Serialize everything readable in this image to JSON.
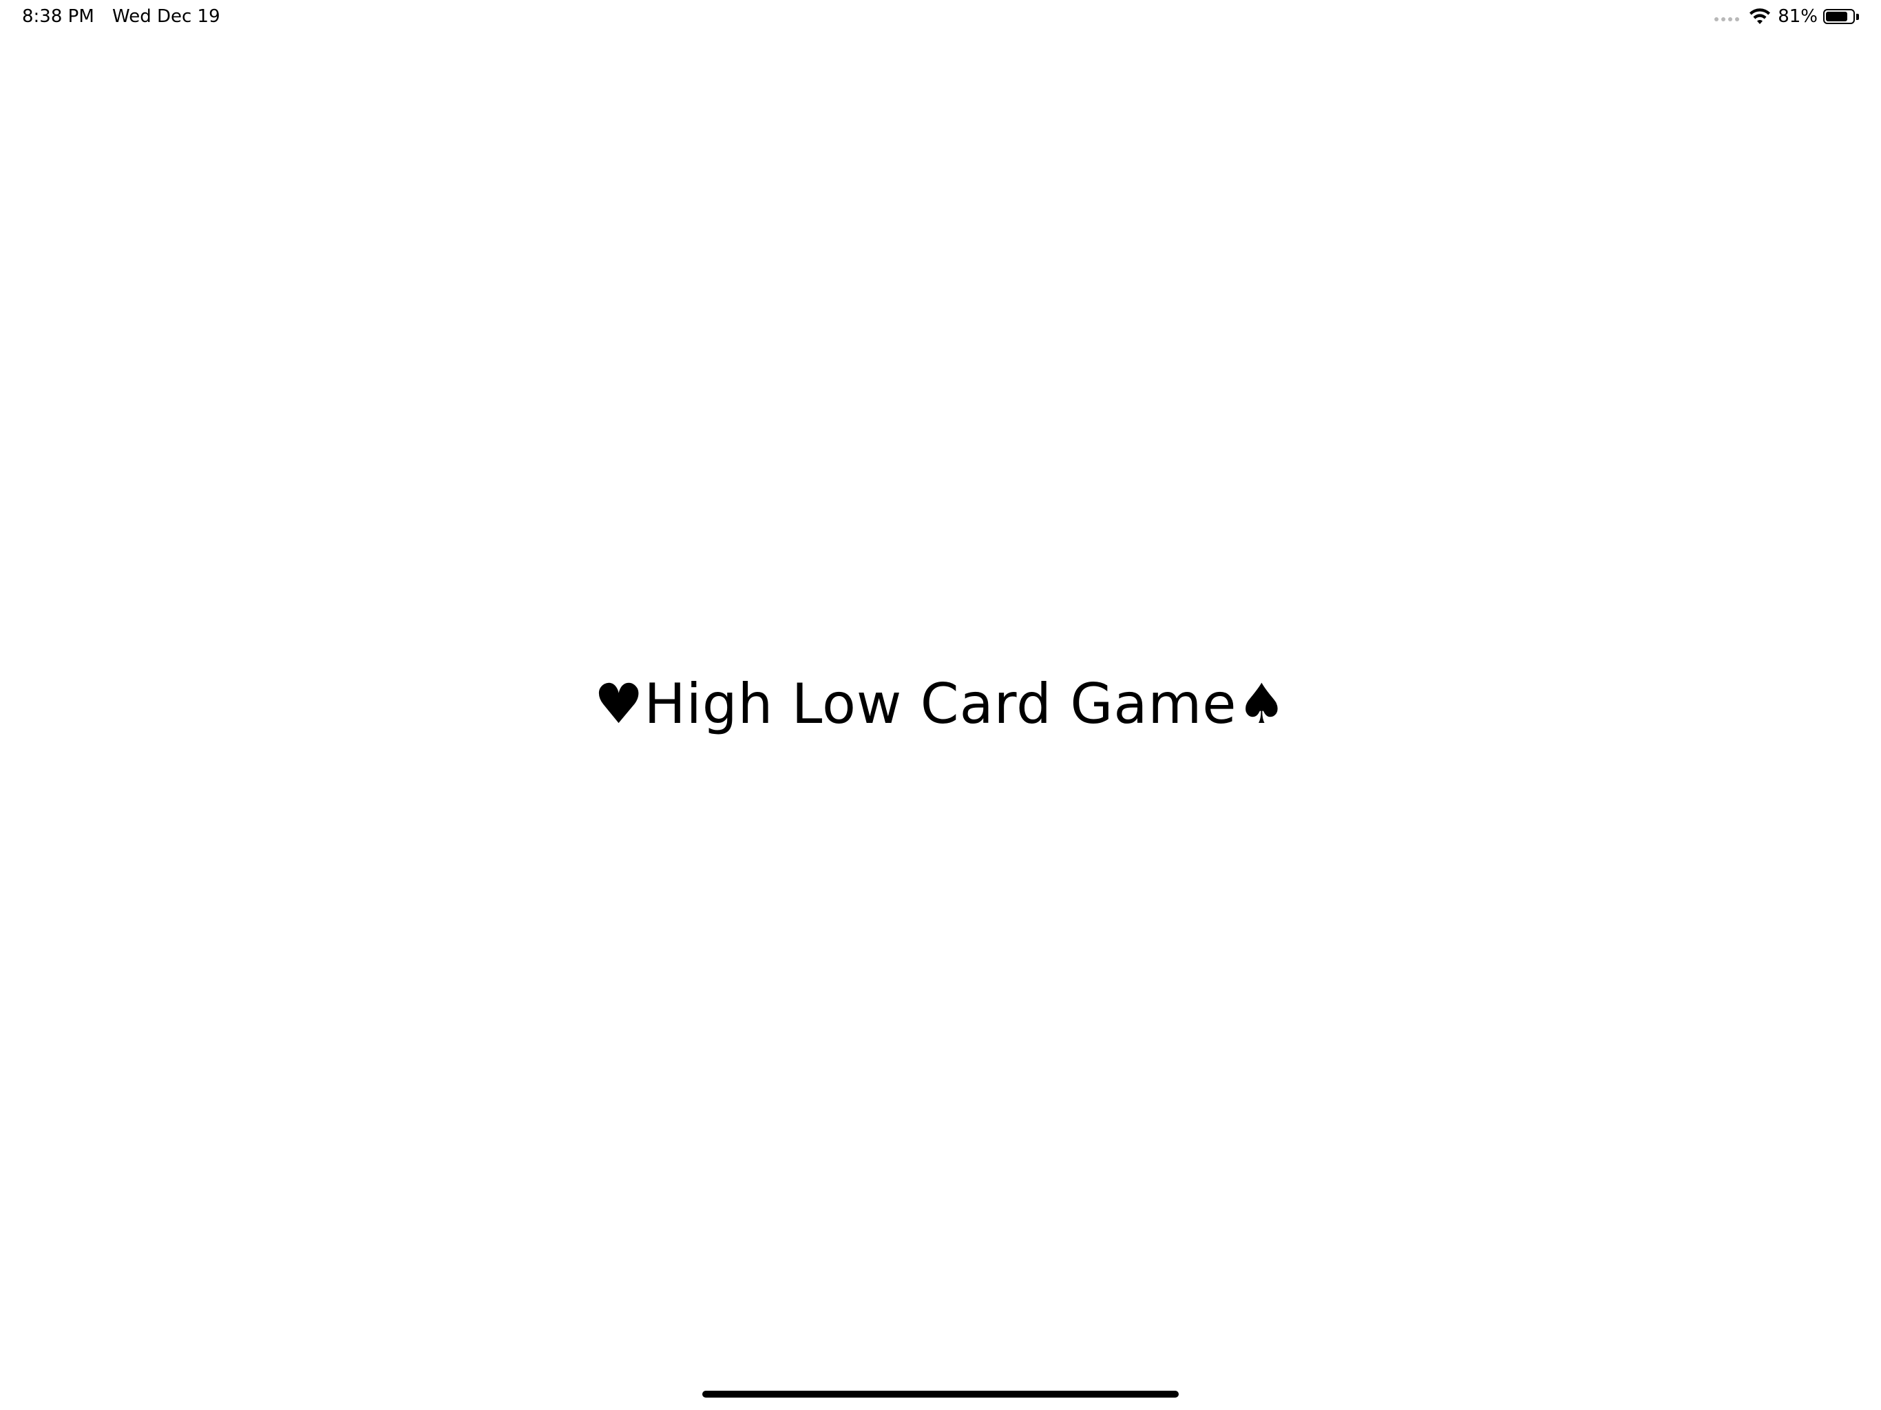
{
  "status_bar": {
    "time": "8:38 PM",
    "date": "Wed Dec 19",
    "battery_percent_label": "81%",
    "battery_level": 0.81,
    "cell_signal_icon": "cellular-no-signal-dots",
    "wifi_icon": "wifi-icon",
    "battery_icon": "battery-icon"
  },
  "main": {
    "title": "♥High Low Card Game♠"
  },
  "colors": {
    "background": "#ffffff",
    "text": "#000000"
  }
}
